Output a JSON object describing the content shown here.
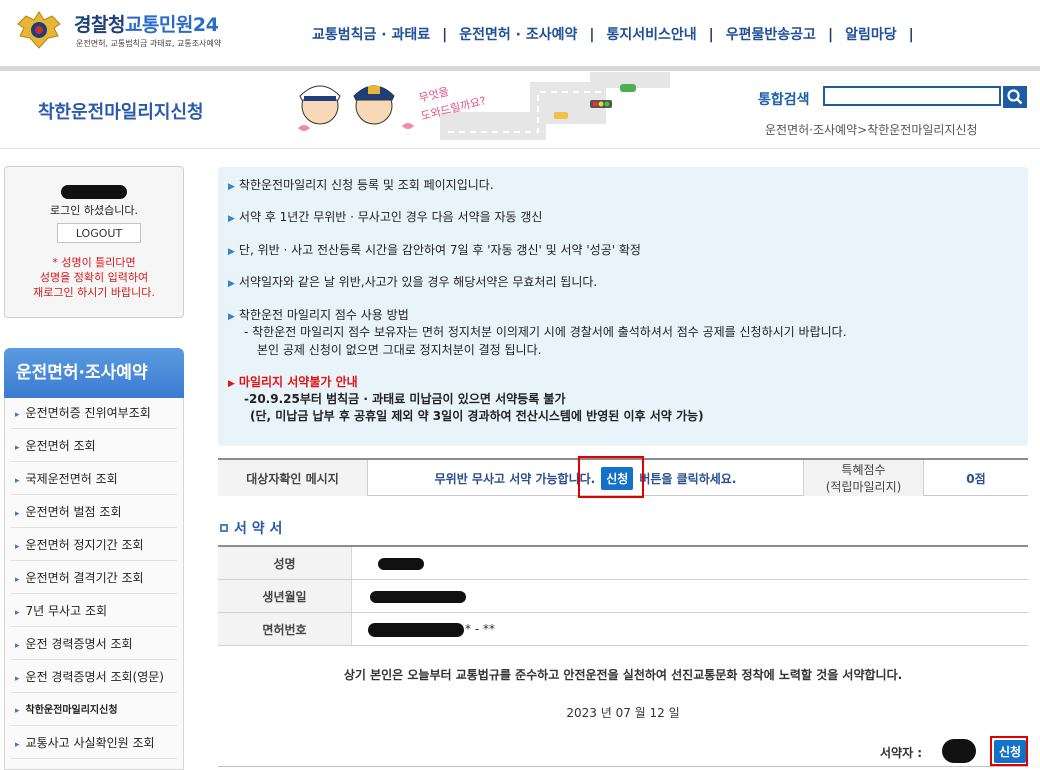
{
  "header": {
    "logo_main": "경찰청",
    "logo_accent": "교통민원24",
    "logo_sub": "운전면허, 교통범칙금 과태료, 교통조사예약",
    "nav": [
      "교통범칙금 · 과태료",
      "운전면허 · 조사예약",
      "통지서비스안내",
      "우편물반송공고",
      "알림마당"
    ],
    "nav_sep": "|"
  },
  "subheader": {
    "page_title": "착한운전마일리지신청",
    "mascot_text_line1": "무엇을",
    "mascot_text_line2": "도와드릴까요?",
    "search_label": "통합검색",
    "search_value": "",
    "breadcrumb": "운전면허·조사예약>착한운전마일리지신청"
  },
  "login": {
    "message": "로그인 하셨습니다.",
    "logout_label": "LOGOUT",
    "warning_line1": "* 성명이 틀리다면",
    "warning_line2": "성명을 정확히 입력하여",
    "warning_line3": "재로그인 하시기 바랍니다."
  },
  "sidebar": {
    "title": "운전면허·조사예약",
    "items": [
      {
        "label": "운전면허증 진위여부조회"
      },
      {
        "label": "운전면허 조회"
      },
      {
        "label": "국제운전면허 조회"
      },
      {
        "label": "운전면허 벌점 조회"
      },
      {
        "label": "운전면허 정지기간 조회"
      },
      {
        "label": "운전면허 결격기간 조회"
      },
      {
        "label": "7년 무사고 조회"
      },
      {
        "label": "운전 경력증명서 조회"
      },
      {
        "label": "운전 경력증명서 조회(영문)"
      },
      {
        "label": "착한운전마일리지신청"
      },
      {
        "label": "교통사고 사실확인원 조회"
      }
    ]
  },
  "info": {
    "line1": "착한운전마일리지 신청 등록 및 조회 페이지입니다.",
    "line2": "서약 후 1년간 무위반 · 무사고인 경우 다음 서약을 자동 갱신",
    "line3": "단, 위반 · 사고 전산등록 시간을 감안하여 7일 후 '자동 갱신' 및 서약 '성공' 확정",
    "line4": "서약일자와 같은 날 위반,사고가 있을 경우 해당서약은 무효처리 됩니다.",
    "line5": "착한운전 마일리지 점수 사용 방법",
    "line5a": "- 착한운전 마일리지 점수 보유자는 면허 정지처분 이의제기 시에 경찰서에 출석하셔서 점수 공제를 신청하시기 바랍니다.",
    "line5b": "본인 공제 신청이 없으면 그대로 정지처분이 결정 됩니다.",
    "notice_title": "마일리지 서약불가 안내",
    "notice_line1": "-20.9.25부터 범칙금 · 과태료 미납금이 있으면 서약등록 불가",
    "notice_line2": "(단, 미납금 납부 후 공휴일 제외 약 3일이 경과하여 전산시스템에 반영된 이후 서약 가능)"
  },
  "status": {
    "label": "대상자확인 메시지",
    "message_before": "무위반 무사고 서약 가능합니다.",
    "apply_label": "신청",
    "message_after": "버튼을 클릭하세요.",
    "points_label_line1": "특혜점수",
    "points_label_line2": "(적립마일리지)",
    "points_value": "0점"
  },
  "pledge": {
    "section_title": "서 약 서",
    "name_label": "성명",
    "birth_label": "생년월일",
    "license_label": "면허번호",
    "license_value_suffix": "* - **",
    "oath_text": "상기 본인은 오늘부터 교통법규를 준수하고 안전운전을 실천하여 선진교통문화 정착에 노력할 것을 서약합니다.",
    "date_text": "2023 년 07 월 12 일",
    "signer_label": "서약자 :",
    "apply_label": "신청"
  },
  "colors": {
    "brand_blue": "#1f4f96",
    "button_blue": "#1371c9",
    "highlight_red": "#e00000",
    "info_bg": "#e9f3fa"
  }
}
